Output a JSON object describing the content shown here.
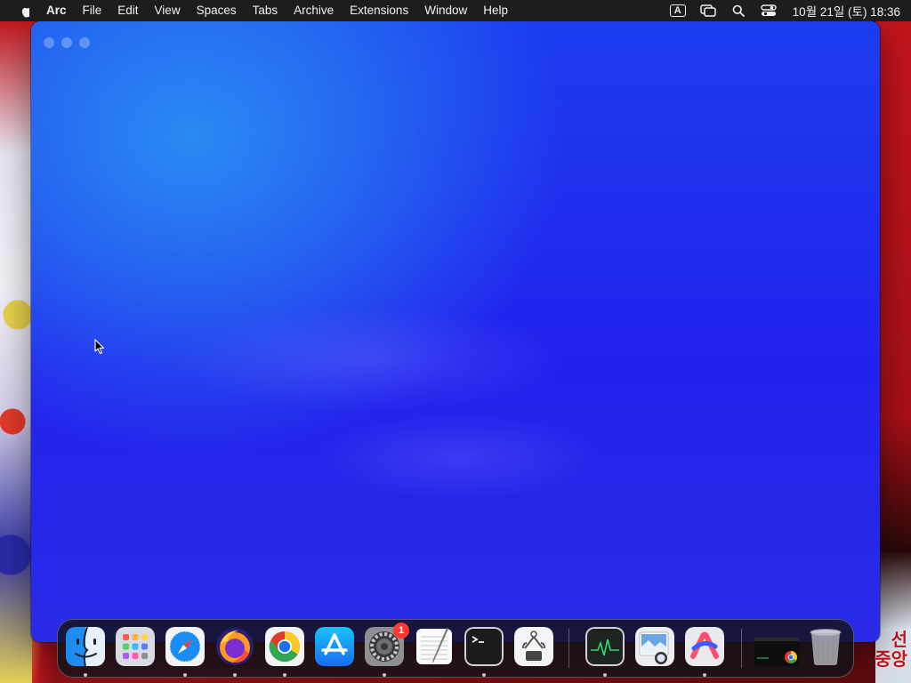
{
  "menubar": {
    "app_name": "Arc",
    "items": [
      "File",
      "Edit",
      "View",
      "Spaces",
      "Tabs",
      "Archive",
      "Extensions",
      "Window",
      "Help"
    ],
    "input_source": "A",
    "clock": "10월 21일 (토) 18:36",
    "status_icons": [
      "input-source-icon",
      "screen-mirroring-icon",
      "spotlight-search-icon",
      "control-center-icon"
    ]
  },
  "window": {
    "app": "Arc",
    "traffic_lights": [
      "close",
      "minimize",
      "zoom"
    ]
  },
  "wallpaper": {
    "text": "선\n중앙"
  },
  "dock": {
    "apps": [
      {
        "name": "Finder",
        "icon": "finder-icon",
        "running": true
      },
      {
        "name": "Launchpad",
        "icon": "launchpad-icon",
        "running": false
      },
      {
        "name": "Safari",
        "icon": "safari-icon",
        "running": true
      },
      {
        "name": "Firefox",
        "icon": "firefox-icon",
        "running": true
      },
      {
        "name": "Google Chrome",
        "icon": "chrome-icon",
        "running": true
      },
      {
        "name": "App Store",
        "icon": "app-store-icon",
        "running": false
      },
      {
        "name": "System Settings",
        "icon": "system-settings-icon",
        "running": true,
        "badge": "1"
      },
      {
        "name": "TextEdit",
        "icon": "textedit-icon",
        "running": false
      },
      {
        "name": "Terminal",
        "icon": "terminal-icon",
        "running": true
      },
      {
        "name": "System Information",
        "icon": "system-information-icon",
        "running": false
      },
      {
        "name": "Activity Monitor",
        "icon": "activity-monitor-icon",
        "running": true
      },
      {
        "name": "Preview",
        "icon": "preview-icon",
        "running": false
      },
      {
        "name": "Arc",
        "icon": "arc-icon",
        "running": true
      },
      {
        "name": "Chrome minimized window",
        "icon": "minimized-window-icon",
        "running": false
      },
      {
        "name": "Trash",
        "icon": "trash-icon",
        "running": false
      }
    ]
  },
  "colors": {
    "menubar_bg": "#1d1d1f",
    "window_bg_top": "#2a8af2",
    "window_bg": "#2222ee",
    "badge": "#ff3b30"
  }
}
